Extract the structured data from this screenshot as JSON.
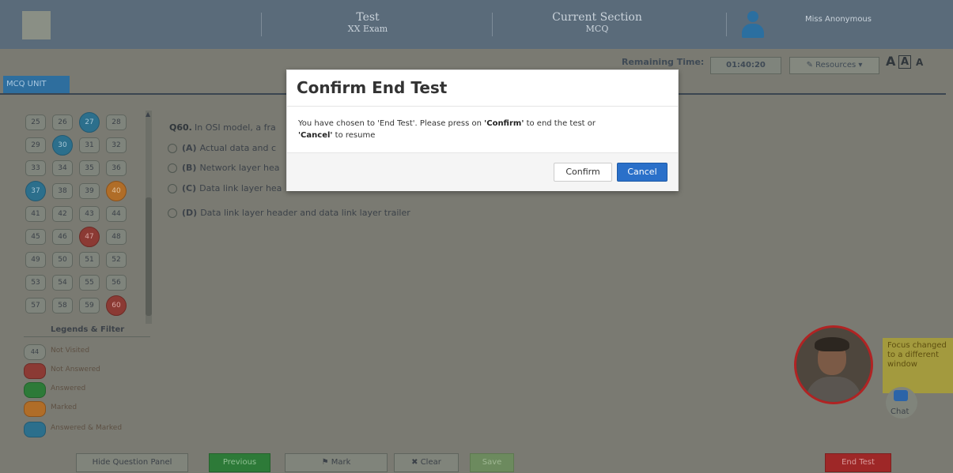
{
  "header": {
    "section_one_title": "Test",
    "section_one_sub": "XX Exam",
    "section_two_title": "Current Section",
    "section_two_sub": "MCQ",
    "user_name": "Miss Anonymous"
  },
  "toolbar": {
    "remaining_label": "Remaining Time:",
    "remaining_value": "01:40:20",
    "resources_label": "✎ Resources ▾",
    "font_small": "A",
    "font_medium": "A",
    "font_large": "A",
    "tab_label": "MCQ UNIT"
  },
  "palette": {
    "rows": [
      [
        {
          "n": "25",
          "s": "nv"
        },
        {
          "n": "26",
          "s": "nv"
        },
        {
          "n": "27",
          "s": "ans"
        },
        {
          "n": "28",
          "s": "nv"
        }
      ],
      [
        {
          "n": "29",
          "s": "nv"
        },
        {
          "n": "30",
          "s": "ans"
        },
        {
          "n": "31",
          "s": "nv"
        },
        {
          "n": "32",
          "s": "nv"
        }
      ],
      [
        {
          "n": "33",
          "s": "nv"
        },
        {
          "n": "34",
          "s": "nv"
        },
        {
          "n": "35",
          "s": "nv"
        },
        {
          "n": "36",
          "s": "nv"
        }
      ],
      [
        {
          "n": "37",
          "s": "ans"
        },
        {
          "n": "38",
          "s": "nv"
        },
        {
          "n": "39",
          "s": "nv"
        },
        {
          "n": "40",
          "s": "mrk"
        }
      ],
      [
        {
          "n": "41",
          "s": "nv"
        },
        {
          "n": "42",
          "s": "nv"
        },
        {
          "n": "43",
          "s": "nv"
        },
        {
          "n": "44",
          "s": "nv"
        }
      ],
      [
        {
          "n": "45",
          "s": "nv"
        },
        {
          "n": "46",
          "s": "nv"
        },
        {
          "n": "47",
          "s": "nans"
        },
        {
          "n": "48",
          "s": "nv"
        }
      ],
      [
        {
          "n": "49",
          "s": "nv"
        },
        {
          "n": "50",
          "s": "nv"
        },
        {
          "n": "51",
          "s": "nv"
        },
        {
          "n": "52",
          "s": "nv"
        }
      ],
      [
        {
          "n": "53",
          "s": "nv"
        },
        {
          "n": "54",
          "s": "nv"
        },
        {
          "n": "55",
          "s": "nv"
        },
        {
          "n": "56",
          "s": "nv"
        }
      ],
      [
        {
          "n": "57",
          "s": "nv"
        },
        {
          "n": "58",
          "s": "nv"
        },
        {
          "n": "59",
          "s": "nv"
        },
        {
          "n": "60",
          "s": "nans"
        }
      ]
    ]
  },
  "legend": {
    "title": "Legends & Filter",
    "items": [
      {
        "icon_value": "44",
        "label": "Not Visited"
      },
      {
        "icon_value": "",
        "label": "Not Answered"
      },
      {
        "icon_value": "",
        "label": "Answered"
      },
      {
        "icon_value": "",
        "label": "Marked"
      },
      {
        "icon_value": "",
        "label": "Answered & Marked"
      }
    ]
  },
  "question": {
    "number": "Q60.",
    "text": "In OSI model, a fra",
    "options": [
      {
        "tag": "(A)",
        "text": "Actual data and c"
      },
      {
        "tag": "(B)",
        "text": "Network layer hea"
      },
      {
        "tag": "(C)",
        "text": "Data link layer hea"
      },
      {
        "tag": "(D)",
        "text": "Data link layer header and data link layer trailer"
      }
    ]
  },
  "bottom": {
    "hide_palette": "Hide Question Panel",
    "previous": "Previous",
    "mark": "⚑ Mark",
    "clear": "✖ Clear",
    "save": "Save",
    "end_test": "End Test"
  },
  "proctor": {
    "notice": "Focus changed to a different window",
    "chat": "Chat"
  },
  "modal": {
    "title": "Confirm End Test",
    "body_pre": "You have chosen to 'End Test'. Please press on ",
    "body_confirm": "'Confirm'",
    "body_mid": " to end the test or",
    "body_cancel": "'Cancel'",
    "body_post": " to resume",
    "confirm": "Confirm",
    "cancel": "Cancel"
  },
  "colors": {
    "cancel_button": "#2a70c9",
    "answered": "#2c6f8c",
    "not_answered": "#8b3a34",
    "marked": "#b06d28",
    "end_test": "#9e2727"
  }
}
